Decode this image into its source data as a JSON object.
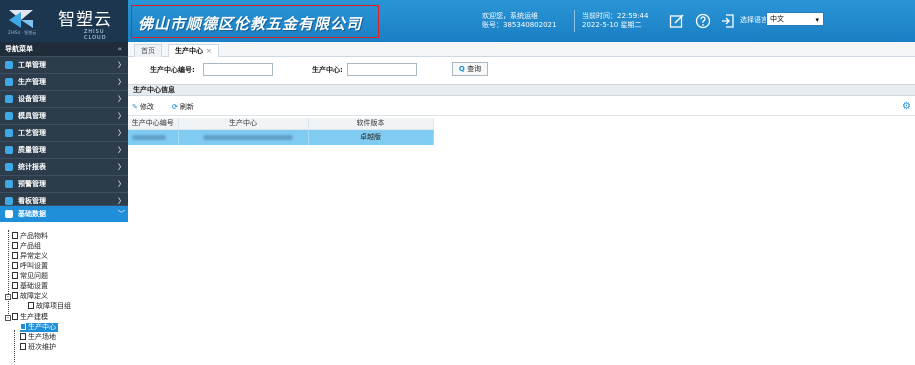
{
  "header": {
    "brand": "智塑云",
    "brand_sub": "ZHISU CLOUD",
    "tagline": "ZHISU · 智塑云",
    "company": "佛山市顺德区伦教五金有限公司",
    "welcome": "欢迎您，系统运维",
    "account": "账号：385340802021",
    "time": "当前时间：22:59:44",
    "date": "2022-5-10 星期二",
    "lang_label": "选择语言",
    "lang_value": "中文"
  },
  "sidebar": {
    "title": "导航菜单",
    "collapse": "«",
    "items": [
      {
        "label": "工单管理"
      },
      {
        "label": "生产管理"
      },
      {
        "label": "设备管理"
      },
      {
        "label": "模具管理"
      },
      {
        "label": "工艺管理"
      },
      {
        "label": "质量管理"
      },
      {
        "label": "统计报表"
      },
      {
        "label": "预警管理"
      },
      {
        "label": "看板管理"
      },
      {
        "label": "基础数据"
      }
    ],
    "tree": [
      "产品物料",
      "产品组",
      "异常定义",
      "呼叫设置",
      "常见问题",
      "基础设置",
      "故障定义",
      "故障项目组",
      "生产建模",
      "生产中心",
      "生产场地",
      "班次维护"
    ]
  },
  "tabs": [
    {
      "label": "首页"
    },
    {
      "label": "生产中心",
      "close": "×"
    }
  ],
  "filters": {
    "code_label": "生产中心编号:",
    "name_label": "生产中心:",
    "search_label": "查询"
  },
  "panel": {
    "title": "生产中心信息"
  },
  "toolbar": {
    "edit_label": "修改",
    "refresh_label": "刷新"
  },
  "table": {
    "columns": [
      "生产中心编号",
      "生产中心",
      "软件版本"
    ],
    "rows": [
      {
        "version": "卓越版"
      }
    ]
  }
}
